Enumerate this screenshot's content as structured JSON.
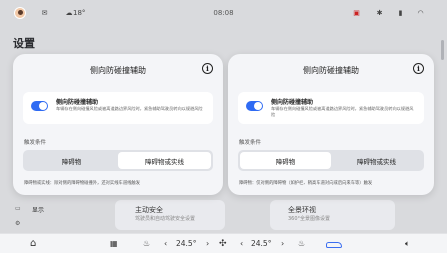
{
  "status": {
    "temperature": "18°",
    "time": "08:08",
    "battery_label": ""
  },
  "settings": {
    "title": "设置"
  },
  "background": {
    "sidebar_item": "显示",
    "panel1_title": "主动安全",
    "panel1_sub": "驾驶员和自动驾驶安全设置",
    "panel2_title": "全景环视",
    "panel2_sub": "360°全景图像设置"
  },
  "dialogs": [
    {
      "title": "侧向防碰撞辅助",
      "card_title": "侧向防碰撞辅助",
      "card_desc": "车辆存在侧向碰撞风险或被离道路边界风险时，紧急辅助驾驶员转向以规避风险",
      "section_label": "触发条件",
      "options": [
        "障碍物",
        "障碍物或实线"
      ],
      "selected": 1,
      "note": "障碍物或实线：除对侧的障碍物碰撞外，还对实线车道线触发"
    },
    {
      "title": "侧向防碰撞辅助",
      "card_title": "侧向防碰撞辅助",
      "card_desc": "车辆存在侧向碰撞风险或被离道路边界风险时，紧急辅助驾驶员转向以规避风险",
      "section_label": "触发条件",
      "options": [
        "障碍物",
        "障碍物或实线"
      ],
      "selected": 0,
      "note": "障碍物：仅对侧的障碍物（如护栏、稍高车道对向或后向来车等）触发"
    }
  ],
  "dock": {
    "left_temp": "24.5°",
    "right_temp": "24.5°",
    "left_arrow": "‹",
    "left_arrow_r": "›",
    "right_arrow": "‹",
    "right_arrow_r": "›"
  },
  "icons": {
    "home": "home-icon",
    "seat_heat": "seat-heat-icon",
    "fan": "fan-icon",
    "car": "car-icon",
    "volume": "volume-icon"
  },
  "colors": {
    "accent": "#2f6bf3"
  }
}
